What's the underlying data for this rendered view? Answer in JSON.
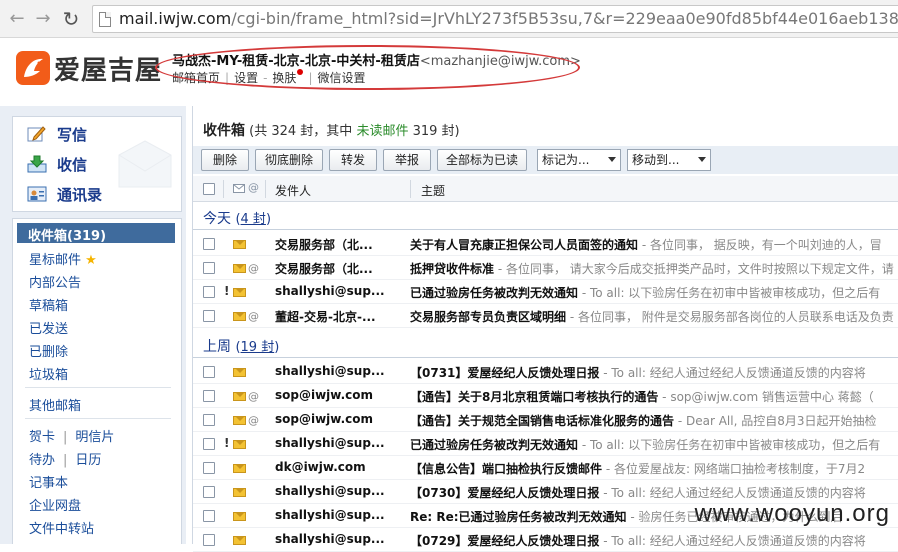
{
  "browser": {
    "url_host": "mail.iwjw.com",
    "url_rest": "/cgi-bin/frame_html?sid=JrVhLY273f5B53su,7&r=229eaa0e90fd85bf44e016aeb1381952"
  },
  "header": {
    "logo_text": "爱屋吉屋",
    "user_name": "马战杰-MY-租赁-北京-北京-中关村-租赁店",
    "user_email": "<mazhanjie@iwjw.com>",
    "links": [
      "邮箱首页",
      "设置",
      "换肤",
      "微信设置"
    ]
  },
  "sidebar": {
    "quick": [
      {
        "label": "写信",
        "icon": "pencil-icon"
      },
      {
        "label": "收信",
        "icon": "inbox-download-icon"
      },
      {
        "label": "通讯录",
        "icon": "contacts-icon"
      }
    ],
    "inbox_label": "收件箱(319)",
    "starred_label": "星标邮件",
    "folders": [
      "内部公告",
      "草稿箱",
      "已发送",
      "已删除",
      "垃圾箱"
    ],
    "other_label": "其他邮箱",
    "apps": [
      "贺卡",
      "明信片",
      "待办",
      "日历",
      "记事本",
      "企业网盘",
      "文件中转站"
    ]
  },
  "main": {
    "folder_name": "收件箱",
    "count_text": "(共 324 封，其中",
    "unread_text": "未读邮件",
    "unread_count": "319 封)",
    "toolbar": {
      "delete": "删除",
      "purge": "彻底删除",
      "forward": "转发",
      "report": "举报",
      "mark_all_read": "全部标为已读",
      "mark_as": "标记为...",
      "move_to": "移动到..."
    },
    "columns": {
      "from": "发件人",
      "subject": "主题"
    },
    "groups": [
      {
        "label": "今天",
        "count_open": "(",
        "count": "4 封",
        "count_close": ")",
        "rows": [
          {
            "from": "交易服务部（北...",
            "subject": "关于有人冒充康正担保公司人员面签的通知",
            "preview": " - 各位同事， 据反映，有一个叫刘迪的人，冒",
            "important": false,
            "attach": false
          },
          {
            "from": "交易服务部（北...",
            "subject": "抵押贷收件标准",
            "preview": " - 各位同事， 请大家今后成交抵押类产品时，文件时按照以下规定文件，请",
            "important": false,
            "attach": true
          },
          {
            "from": "shallyshi@sup...",
            "subject": "已通过验房任务被改判无效通知",
            "preview": " - To all: 以下验房任务在初审中皆被审核成功，但之后有",
            "important": true,
            "attach": false
          },
          {
            "from": "董超-交易-北京-...",
            "subject": "交易服务部专员负责区域明细",
            "preview": " - 各位同事， 附件是交易服务部各岗位的人员联系电话及负责",
            "important": false,
            "attach": true
          }
        ]
      },
      {
        "label": "上周",
        "count_open": "(",
        "count": "19 封",
        "count_close": ")",
        "rows": [
          {
            "from": "shallyshi@sup...",
            "subject": "【0731】爱屋经纪人反馈处理日报",
            "preview": " - To all: 经纪人通过经纪人反馈通道反馈的内容将",
            "important": false,
            "attach": false
          },
          {
            "from": "sop@iwjw.com",
            "subject": "【通告】关于8月北京租赁端口考核执行的通告",
            "preview": " - sop@iwjw.com 销售运营中心 蒋懿（",
            "important": false,
            "attach": true
          },
          {
            "from": "sop@iwjw.com",
            "subject": "【通告】关于规范全国销售电话标准化服务的通告",
            "preview": " - Dear All, 品控自8月3日起开始抽检",
            "important": false,
            "attach": true
          },
          {
            "from": "shallyshi@sup...",
            "subject": "已通过验房任务被改判无效通知",
            "preview": " - To all: 以下验房任务在初审中皆被审核成功，但之后有",
            "important": true,
            "attach": false
          },
          {
            "from": "dk@iwjw.com",
            "subject": "【信息公告】端口抽检执行反馈邮件",
            "preview": " - 各位爱屋战友: 网络端口抽检考核制度，于7月2",
            "important": false,
            "attach": false
          },
          {
            "from": "shallyshi@sup...",
            "subject": "【0730】爱屋经纪人反馈处理日报",
            "preview": " - To all: 经纪人通过经纪人反馈通道反馈的内容将",
            "important": false,
            "attach": false
          },
          {
            "from": "shallyshi@sup...",
            "subject": "Re: Re:已通过验房任务被改判无效通知",
            "preview": " - 验房任务已经被审核通过，为什么到后",
            "important": false,
            "attach": false
          },
          {
            "from": "shallyshi@sup...",
            "subject": "【0729】爱屋经纪人反馈处理日报",
            "preview": " - To all: 经纪人通过经纪人反馈通道反馈的内容将",
            "important": false,
            "attach": false
          }
        ]
      }
    ]
  },
  "watermark": "www.wooyun.org",
  "colors": {
    "accent": "#1a3b8c",
    "selected": "#3f6b9d",
    "unread_green": "#2b8c2b",
    "annotation_red": "#d43a3a",
    "logo_orange": "#f25c19"
  }
}
